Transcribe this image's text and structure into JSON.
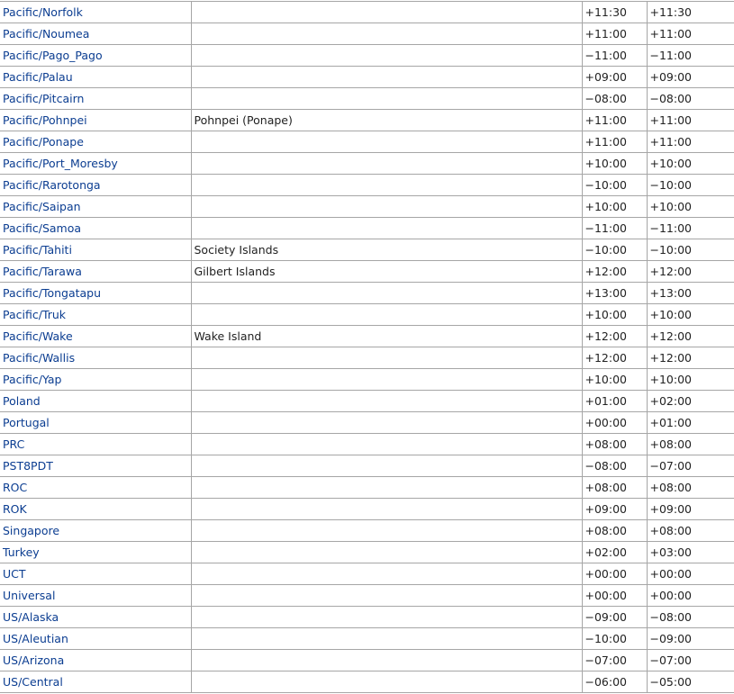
{
  "table": {
    "rows": [
      {
        "zone": "Pacific/Norfolk",
        "note": "",
        "std": "+11:30",
        "dst": "+11:30"
      },
      {
        "zone": "Pacific/Noumea",
        "note": "",
        "std": "+11:00",
        "dst": "+11:00"
      },
      {
        "zone": "Pacific/Pago_Pago",
        "note": "",
        "std": "−11:00",
        "dst": "−11:00"
      },
      {
        "zone": "Pacific/Palau",
        "note": "",
        "std": "+09:00",
        "dst": "+09:00"
      },
      {
        "zone": "Pacific/Pitcairn",
        "note": "",
        "std": "−08:00",
        "dst": "−08:00"
      },
      {
        "zone": "Pacific/Pohnpei",
        "note": "Pohnpei (Ponape)",
        "std": "+11:00",
        "dst": "+11:00"
      },
      {
        "zone": "Pacific/Ponape",
        "note": "",
        "std": "+11:00",
        "dst": "+11:00"
      },
      {
        "zone": "Pacific/Port_Moresby",
        "note": "",
        "std": "+10:00",
        "dst": "+10:00"
      },
      {
        "zone": "Pacific/Rarotonga",
        "note": "",
        "std": "−10:00",
        "dst": "−10:00"
      },
      {
        "zone": "Pacific/Saipan",
        "note": "",
        "std": "+10:00",
        "dst": "+10:00"
      },
      {
        "zone": "Pacific/Samoa",
        "note": "",
        "std": "−11:00",
        "dst": "−11:00"
      },
      {
        "zone": "Pacific/Tahiti",
        "note": "Society Islands",
        "std": "−10:00",
        "dst": "−10:00"
      },
      {
        "zone": "Pacific/Tarawa",
        "note": "Gilbert Islands",
        "std": "+12:00",
        "dst": "+12:00"
      },
      {
        "zone": "Pacific/Tongatapu",
        "note": "",
        "std": "+13:00",
        "dst": "+13:00"
      },
      {
        "zone": "Pacific/Truk",
        "note": "",
        "std": "+10:00",
        "dst": "+10:00"
      },
      {
        "zone": "Pacific/Wake",
        "note": "Wake Island",
        "std": "+12:00",
        "dst": "+12:00"
      },
      {
        "zone": "Pacific/Wallis",
        "note": "",
        "std": "+12:00",
        "dst": "+12:00"
      },
      {
        "zone": "Pacific/Yap",
        "note": "",
        "std": "+10:00",
        "dst": "+10:00"
      },
      {
        "zone": "Poland",
        "note": "",
        "std": "+01:00",
        "dst": "+02:00"
      },
      {
        "zone": "Portugal",
        "note": "",
        "std": "+00:00",
        "dst": "+01:00"
      },
      {
        "zone": "PRC",
        "note": "",
        "std": "+08:00",
        "dst": "+08:00"
      },
      {
        "zone": "PST8PDT",
        "note": "",
        "std": "−08:00",
        "dst": "−07:00"
      },
      {
        "zone": "ROC",
        "note": "",
        "std": "+08:00",
        "dst": "+08:00"
      },
      {
        "zone": "ROK",
        "note": "",
        "std": "+09:00",
        "dst": "+09:00"
      },
      {
        "zone": "Singapore",
        "note": "",
        "std": "+08:00",
        "dst": "+08:00"
      },
      {
        "zone": "Turkey",
        "note": "",
        "std": "+02:00",
        "dst": "+03:00"
      },
      {
        "zone": "UCT",
        "note": "",
        "std": "+00:00",
        "dst": "+00:00"
      },
      {
        "zone": "Universal",
        "note": "",
        "std": "+00:00",
        "dst": "+00:00"
      },
      {
        "zone": "US/Alaska",
        "note": "",
        "std": "−09:00",
        "dst": "−08:00"
      },
      {
        "zone": "US/Aleutian",
        "note": "",
        "std": "−10:00",
        "dst": "−09:00"
      },
      {
        "zone": "US/Arizona",
        "note": "",
        "std": "−07:00",
        "dst": "−07:00"
      },
      {
        "zone": "US/Central",
        "note": "",
        "std": "−06:00",
        "dst": "−05:00"
      }
    ]
  },
  "colors": {
    "link": "#0b3d91",
    "text": "#222222",
    "border": "#a6a6a6",
    "background": "#ffffff"
  }
}
